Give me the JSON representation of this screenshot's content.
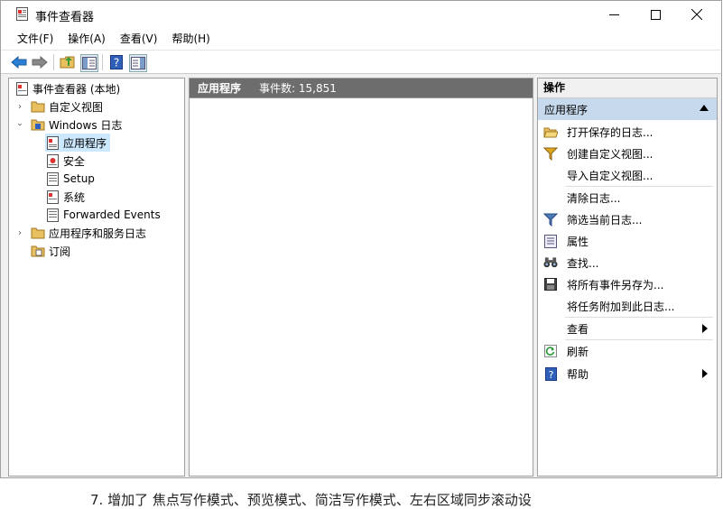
{
  "window": {
    "title": "事件查看器",
    "controls": {
      "minimize": "—",
      "maximize": "☐",
      "close": "✕"
    }
  },
  "menu": [
    "文件(F)",
    "操作(A)",
    "查看(V)",
    "帮助(H)"
  ],
  "toolbar": {
    "icons": [
      "back-arrow-icon",
      "forward-arrow-icon",
      "up-folder-icon",
      "show-hide-tree-icon",
      "help-icon",
      "show-hide-action-pane-icon"
    ]
  },
  "tree": {
    "root": "事件查看器 (本地)",
    "custom_views": "自定义视图",
    "windows_logs": "Windows 日志",
    "application": "应用程序",
    "security": "安全",
    "setup": "Setup",
    "system": "系统",
    "forwarded": "Forwarded Events",
    "apps_services": "应用程序和服务日志",
    "subscriptions": "订阅"
  },
  "center": {
    "log_name": "应用程序",
    "event_count": "事件数: 15,851"
  },
  "actions": {
    "header": "操作",
    "section": "应用程序",
    "items": {
      "open_saved": "打开保存的日志...",
      "create_view": "创建自定义视图...",
      "import_view": "导入自定义视图...",
      "clear_log": "清除日志...",
      "filter": "筛选当前日志...",
      "properties": "属性",
      "find": "查找...",
      "save_all": "将所有事件另存为...",
      "attach_task": "将任务附加到此日志...",
      "view": "查看",
      "refresh": "刷新",
      "help": "帮助"
    }
  },
  "background": {
    "bottom_text": "7. 增加了 焦点写作模式、预览模式、简洁写作模式、左右区域同步滚动设"
  },
  "colors": {
    "selection": "#cce8ff",
    "center_header": "#6d6d6d",
    "action_section": "#c7d9ed"
  }
}
